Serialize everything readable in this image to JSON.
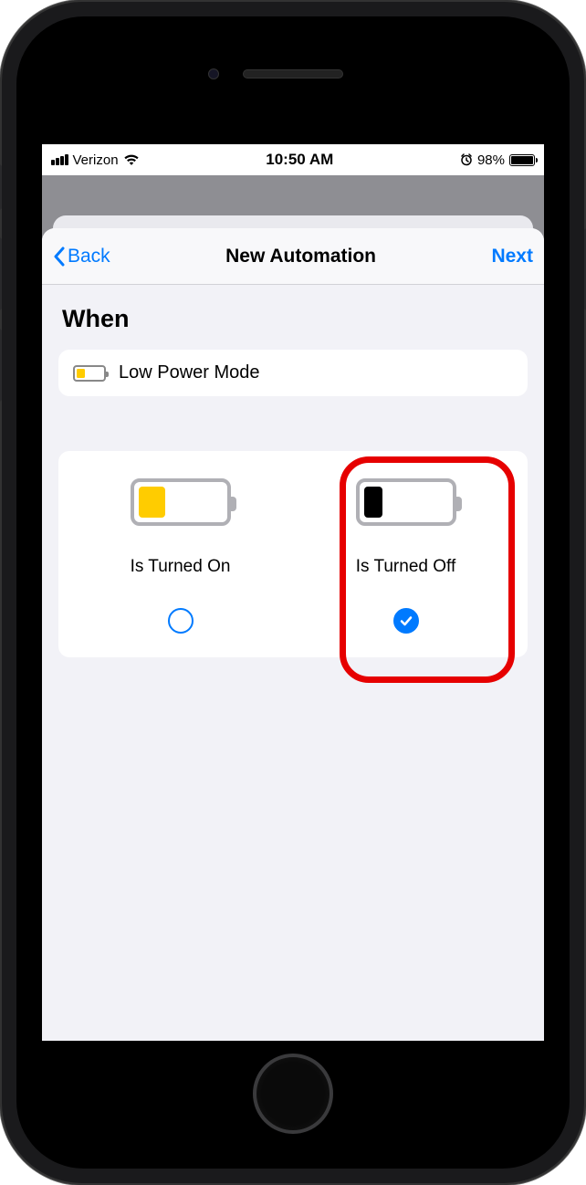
{
  "status_bar": {
    "carrier": "Verizon",
    "time": "10:50 AM",
    "battery_pct": "98%",
    "battery_fill_pct": 98
  },
  "nav": {
    "back_label": "Back",
    "title": "New Automation",
    "next_label": "Next"
  },
  "section": {
    "heading": "When",
    "trigger": {
      "label": "Low Power Mode",
      "icon_fill_color": "#ffcc00",
      "icon_fill_pct": 32
    }
  },
  "options": {
    "on": {
      "label": "Is Turned On",
      "fill_color": "#ffcc00",
      "fill_pct": 32,
      "selected": false
    },
    "off": {
      "label": "Is Turned Off",
      "fill_color": "#000000",
      "fill_pct": 22,
      "selected": true
    }
  },
  "colors": {
    "accent": "#007aff",
    "highlight": "#e60000"
  }
}
